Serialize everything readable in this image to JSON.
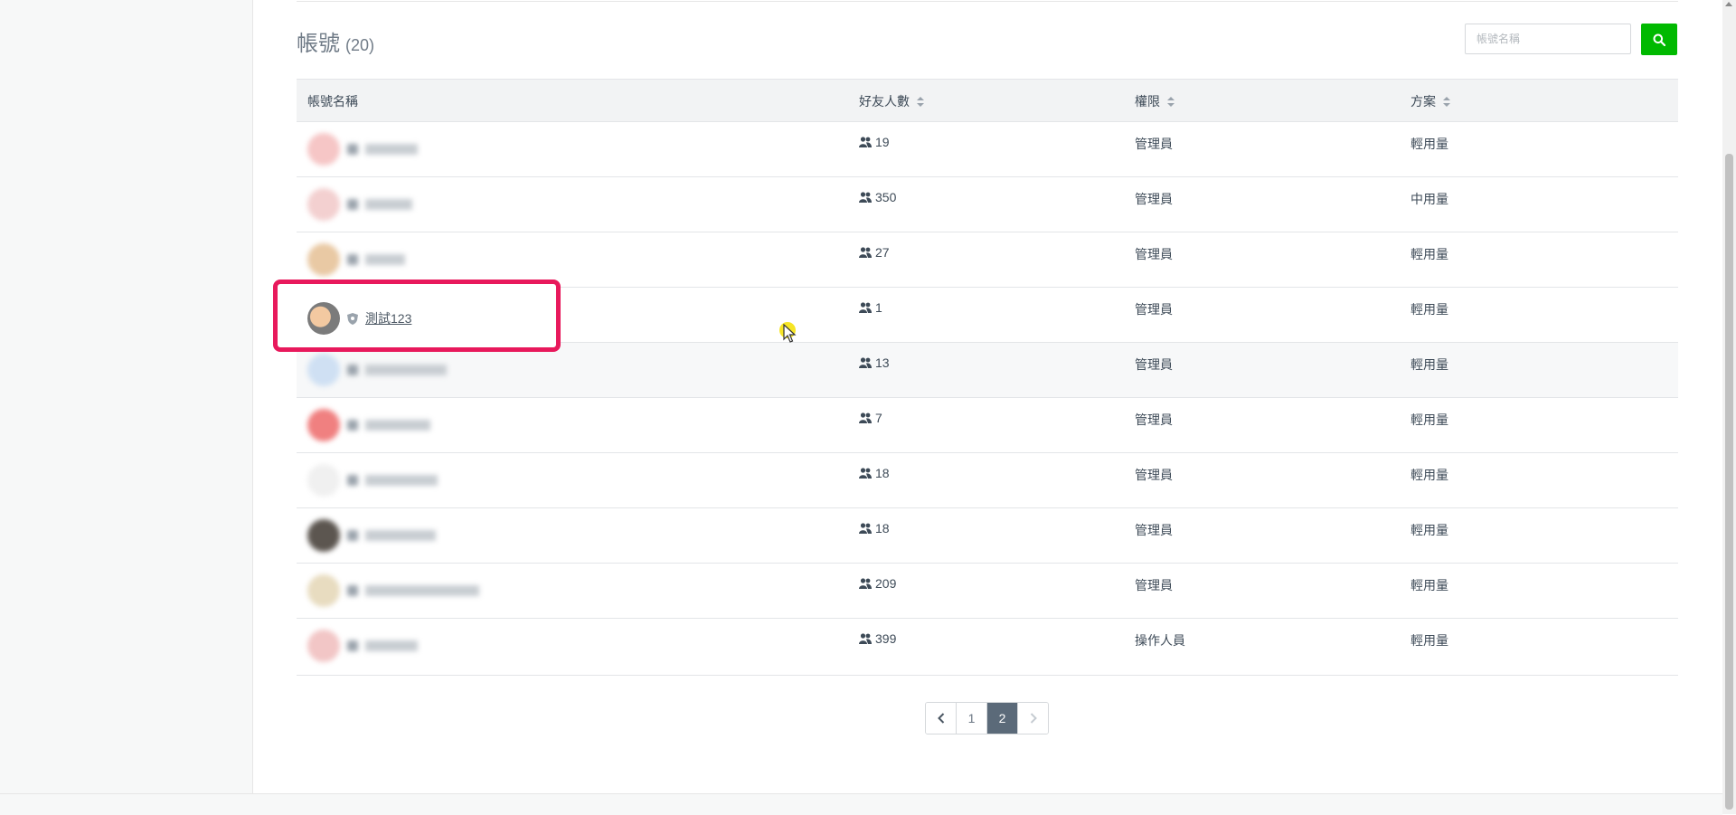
{
  "header": {
    "title": "帳號",
    "count": "(20)"
  },
  "search": {
    "placeholder": "帳號名稱"
  },
  "table": {
    "columns": [
      "帳號名稱",
      "好友人數",
      "權限",
      "方案"
    ],
    "rows": [
      {
        "name": "",
        "friends": "19",
        "role": "管理員",
        "plan": "輕用量"
      },
      {
        "name": "",
        "friends": "350",
        "role": "管理員",
        "plan": "中用量"
      },
      {
        "name": "",
        "friends": "27",
        "role": "管理員",
        "plan": "輕用量"
      },
      {
        "name": "測試123",
        "friends": "1",
        "role": "管理員",
        "plan": "輕用量"
      },
      {
        "name": "",
        "friends": "13",
        "role": "管理員",
        "plan": "輕用量"
      },
      {
        "name": "",
        "friends": "7",
        "role": "管理員",
        "plan": "輕用量"
      },
      {
        "name": "",
        "friends": "18",
        "role": "管理員",
        "plan": "輕用量"
      },
      {
        "name": "",
        "friends": "18",
        "role": "管理員",
        "plan": "輕用量"
      },
      {
        "name": "",
        "friends": "209",
        "role": "管理員",
        "plan": "輕用量"
      },
      {
        "name": "",
        "friends": "399",
        "role": "操作人員",
        "plan": "輕用量"
      }
    ]
  },
  "pagination": {
    "pages": [
      "1",
      "2"
    ],
    "current": "2"
  },
  "colors": {
    "accent": "#00b900",
    "highlight": "#e8195c",
    "active_page": "#5b6a79"
  }
}
